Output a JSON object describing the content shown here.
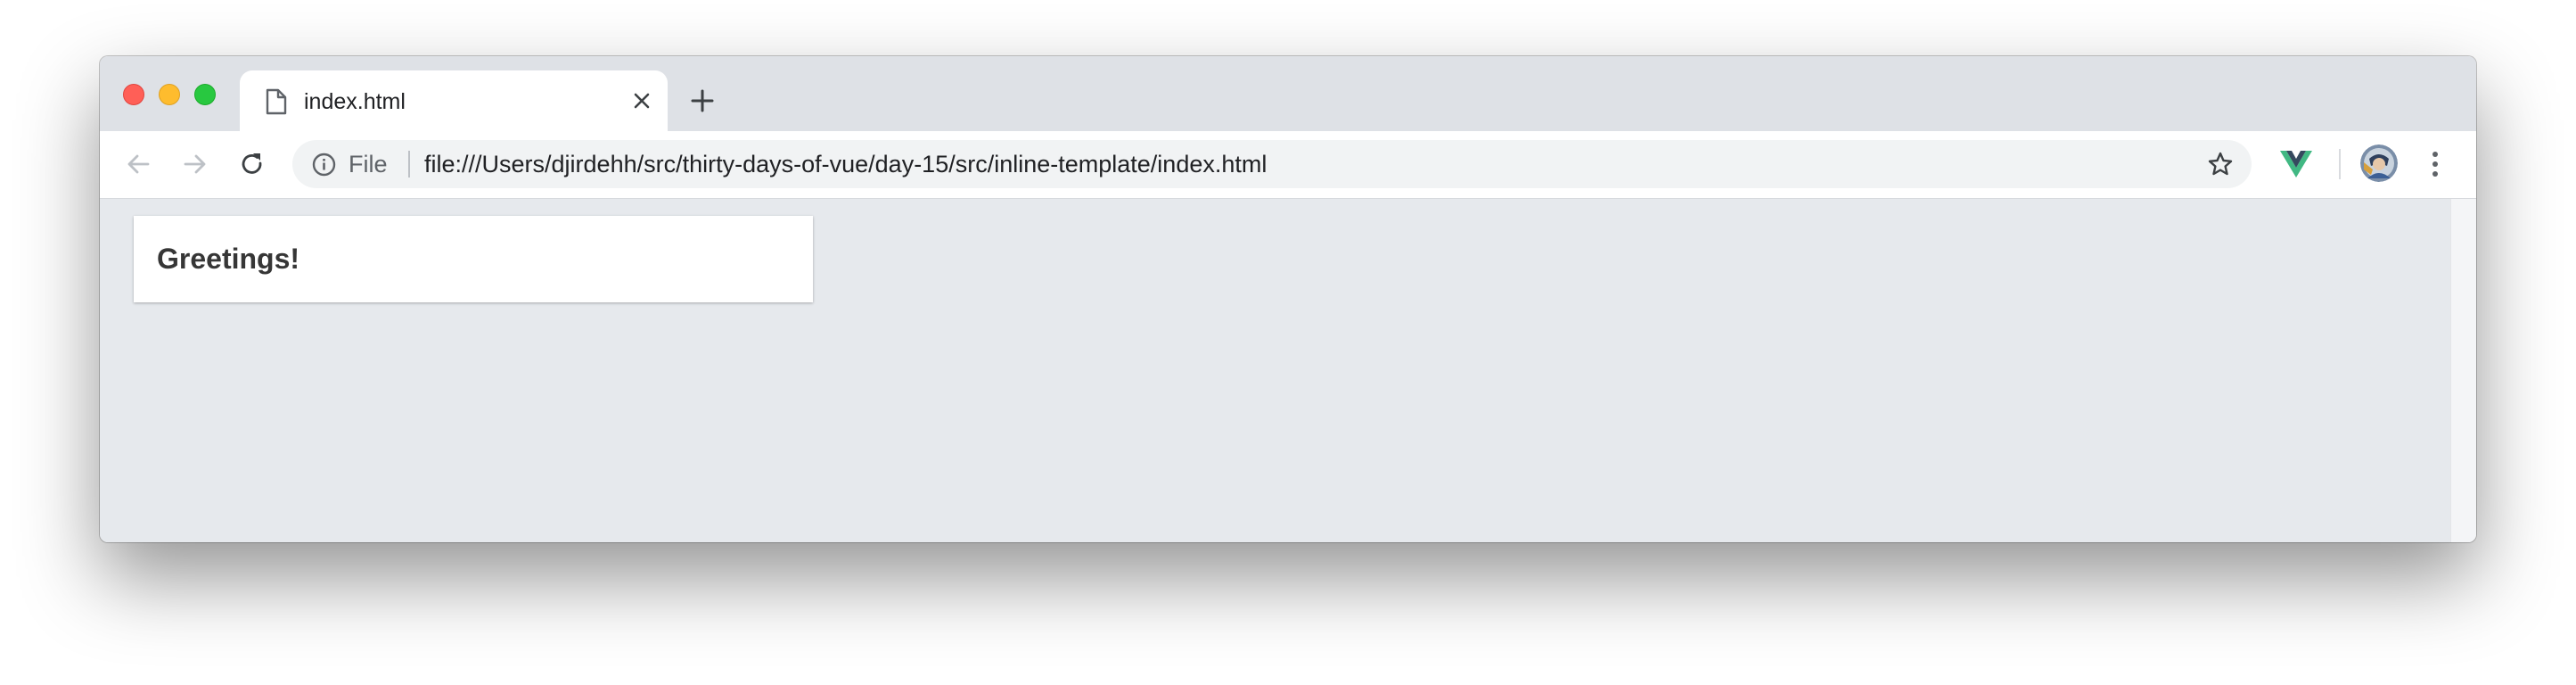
{
  "browser": {
    "tab": {
      "title": "index.html"
    },
    "omnibox": {
      "scheme_label": "File",
      "url": "file:///Users/djirdehh/src/thirty-days-of-vue/day-15/src/inline-template/index.html"
    },
    "icons": {
      "tab_doc": "document-icon",
      "tab_close": "close-icon",
      "new_tab": "plus-icon",
      "back": "arrow-left-icon",
      "forward": "arrow-right-icon",
      "reload": "reload-icon",
      "info": "info-icon",
      "bookmark": "star-icon",
      "extension": "vue-devtools-icon",
      "profile": "avatar",
      "menu": "kebab-menu-icon"
    },
    "colors": {
      "traffic_close": "#ff5f57",
      "traffic_minimize": "#febc2e",
      "traffic_maximize": "#28c840",
      "vue_green": "#41b883",
      "vue_dark": "#35495e"
    }
  },
  "page": {
    "card_title": "Greetings!"
  }
}
